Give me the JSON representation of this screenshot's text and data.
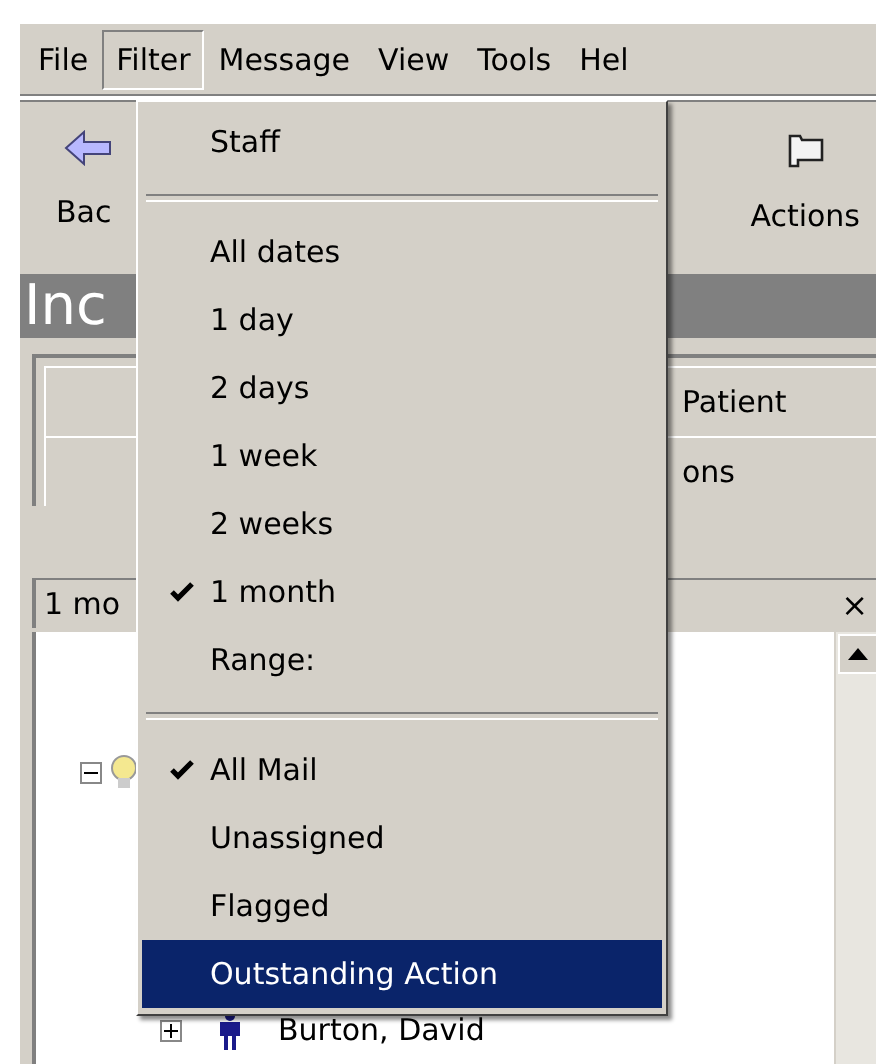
{
  "menu_bar": [
    {
      "label": "File",
      "selected": false
    },
    {
      "label": "Filter",
      "selected": true
    },
    {
      "label": "Message",
      "selected": false
    },
    {
      "label": "View",
      "selected": false
    },
    {
      "label": "Tools",
      "selected": false
    },
    {
      "label": "Hel",
      "selected": false
    }
  ],
  "toolbar": [
    {
      "kind": "back",
      "label": "Bac"
    },
    {
      "kind": "actions",
      "label": "Actions"
    }
  ],
  "title": "Inc",
  "tabs": [
    {
      "label": "Patient"
    },
    {
      "label": "ons"
    }
  ],
  "filter_bar": {
    "label": "1 mo",
    "close": "×"
  },
  "tree": [
    {
      "expanded": true,
      "children": [
        {
          "label": "Burton, David",
          "expanded": false
        }
      ]
    }
  ],
  "filter_menu": [
    {
      "kind": "item",
      "label": "Staff",
      "checked": false,
      "selected": false
    },
    {
      "kind": "separator"
    },
    {
      "kind": "item",
      "label": "All dates",
      "checked": false,
      "selected": false
    },
    {
      "kind": "item",
      "label": "1 day",
      "checked": false,
      "selected": false
    },
    {
      "kind": "item",
      "label": "2 days",
      "checked": false,
      "selected": false
    },
    {
      "kind": "item",
      "label": "1 week",
      "checked": false,
      "selected": false
    },
    {
      "kind": "item",
      "label": "2 weeks",
      "checked": false,
      "selected": false
    },
    {
      "kind": "item",
      "label": "1 month",
      "checked": true,
      "selected": false
    },
    {
      "kind": "item",
      "label": "Range:",
      "checked": false,
      "selected": false
    },
    {
      "kind": "separator"
    },
    {
      "kind": "item",
      "label": "All Mail",
      "checked": true,
      "selected": false
    },
    {
      "kind": "item",
      "label": "Unassigned",
      "checked": false,
      "selected": false
    },
    {
      "kind": "item",
      "label": "Flagged",
      "checked": false,
      "selected": false
    },
    {
      "kind": "item",
      "label": "Outstanding Action",
      "checked": false,
      "selected": true
    }
  ]
}
